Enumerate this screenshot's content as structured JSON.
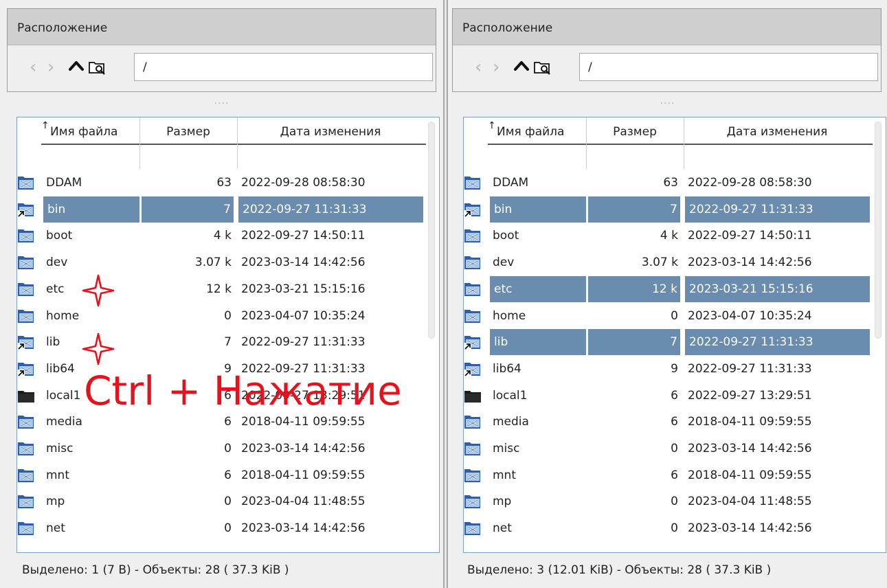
{
  "colors": {
    "background": "#efefef",
    "title_bar": "#cfcfcf",
    "selection": "#6a8cae",
    "list_border": "#7d9fc4",
    "annotation": "#e8101a",
    "folder_icon_blue": "#2f5ea6",
    "folder_icon_light": "#a8c8ee"
  },
  "icons": {
    "back": "chevron-left-icon",
    "forward": "chevron-right-icon",
    "up": "chevron-up-icon",
    "browse": "folder-search-icon",
    "folder": "folder-icon",
    "symlink_folder": "folder-symlink-icon",
    "mount_folder": "black-folder-icon",
    "sort": "sort-ascending-icon"
  },
  "annotation": {
    "text": "Ctrl + Нажатие"
  },
  "panels": [
    {
      "location_title": "Расположение",
      "path": "/",
      "handle_dots": "....",
      "columns": {
        "name": "Имя файла",
        "size": "Размер",
        "date": "Дата изменения"
      },
      "rows": [
        {
          "name": "DDAM",
          "size": "63",
          "date": "2022-09-28 08:58:30",
          "icon": "folder-icon",
          "selected": false
        },
        {
          "name": "bin",
          "size": "7",
          "date": "2022-09-27 11:31:33",
          "icon": "folder-symlink-icon",
          "selected": true
        },
        {
          "name": "boot",
          "size": "4 k",
          "date": "2022-09-27 14:50:11",
          "icon": "folder-icon",
          "selected": false
        },
        {
          "name": "dev",
          "size": "3.07 k",
          "date": "2023-03-14 14:42:56",
          "icon": "folder-icon",
          "selected": false
        },
        {
          "name": "etc",
          "size": "12 k",
          "date": "2023-03-21 15:15:16",
          "icon": "folder-icon",
          "selected": false
        },
        {
          "name": "home",
          "size": "0",
          "date": "2023-04-07 10:35:24",
          "icon": "folder-icon",
          "selected": false
        },
        {
          "name": "lib",
          "size": "7",
          "date": "2022-09-27 11:31:33",
          "icon": "folder-symlink-icon",
          "selected": false
        },
        {
          "name": "lib64",
          "size": "9",
          "date": "2022-09-27 11:31:33",
          "icon": "folder-symlink-icon",
          "selected": false
        },
        {
          "name": "local1",
          "size": "6",
          "date": "2022-09-27 13:29:51",
          "icon": "black-folder-icon",
          "selected": false
        },
        {
          "name": "media",
          "size": "6",
          "date": "2018-04-11 09:59:55",
          "icon": "folder-icon",
          "selected": false
        },
        {
          "name": "misc",
          "size": "0",
          "date": "2023-03-14 14:42:56",
          "icon": "folder-icon",
          "selected": false
        },
        {
          "name": "mnt",
          "size": "6",
          "date": "2018-04-11 09:59:55",
          "icon": "folder-icon",
          "selected": false
        },
        {
          "name": "mp",
          "size": "0",
          "date": "2023-04-04 11:48:55",
          "icon": "folder-icon",
          "selected": false
        },
        {
          "name": "net",
          "size": "0",
          "date": "2023-03-14 14:42:56",
          "icon": "folder-icon",
          "selected": false
        }
      ],
      "status": "Выделено: 1 (7 B)  -  Объекты: 28 ( 37.3 KiB )"
    },
    {
      "location_title": "Расположение",
      "path": "/",
      "handle_dots": "....",
      "columns": {
        "name": "Имя файла",
        "size": "Размер",
        "date": "Дата изменения"
      },
      "rows": [
        {
          "name": "DDAM",
          "size": "63",
          "date": "2022-09-28 08:58:30",
          "icon": "folder-icon",
          "selected": false
        },
        {
          "name": "bin",
          "size": "7",
          "date": "2022-09-27 11:31:33",
          "icon": "folder-symlink-icon",
          "selected": true
        },
        {
          "name": "boot",
          "size": "4 k",
          "date": "2022-09-27 14:50:11",
          "icon": "folder-icon",
          "selected": false
        },
        {
          "name": "dev",
          "size": "3.07 k",
          "date": "2023-03-14 14:42:56",
          "icon": "folder-icon",
          "selected": false
        },
        {
          "name": "etc",
          "size": "12 k",
          "date": "2023-03-21 15:15:16",
          "icon": "folder-icon",
          "selected": true
        },
        {
          "name": "home",
          "size": "0",
          "date": "2023-04-07 10:35:24",
          "icon": "folder-icon",
          "selected": false
        },
        {
          "name": "lib",
          "size": "7",
          "date": "2022-09-27 11:31:33",
          "icon": "folder-symlink-icon",
          "selected": true
        },
        {
          "name": "lib64",
          "size": "9",
          "date": "2022-09-27 11:31:33",
          "icon": "folder-symlink-icon",
          "selected": false
        },
        {
          "name": "local1",
          "size": "6",
          "date": "2022-09-27 13:29:51",
          "icon": "black-folder-icon",
          "selected": false
        },
        {
          "name": "media",
          "size": "6",
          "date": "2018-04-11 09:59:55",
          "icon": "folder-icon",
          "selected": false
        },
        {
          "name": "misc",
          "size": "0",
          "date": "2023-03-14 14:42:56",
          "icon": "folder-icon",
          "selected": false
        },
        {
          "name": "mnt",
          "size": "6",
          "date": "2018-04-11 09:59:55",
          "icon": "folder-icon",
          "selected": false
        },
        {
          "name": "mp",
          "size": "0",
          "date": "2023-04-04 11:48:55",
          "icon": "folder-icon",
          "selected": false
        },
        {
          "name": "net",
          "size": "0",
          "date": "2023-03-14 14:42:56",
          "icon": "folder-icon",
          "selected": false
        }
      ],
      "status": "Выделено: 3 (12.01 KiB)  -  Объекты: 28 ( 37.3 KiB )"
    }
  ]
}
